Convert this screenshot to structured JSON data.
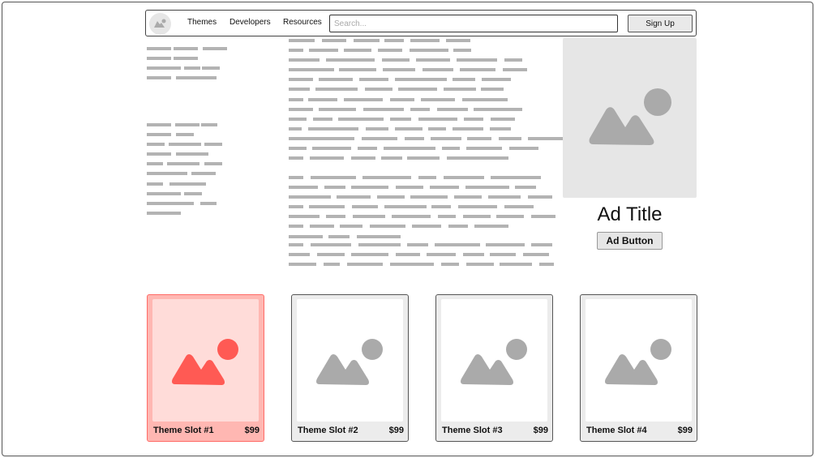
{
  "navbar": {
    "logo_icon": "image-placeholder-icon",
    "links": [
      "Themes",
      "Developers",
      "Resources"
    ],
    "search_placeholder": "Search...",
    "signup_label": "Sign Up"
  },
  "ad": {
    "image_icon": "image-placeholder-icon",
    "title": "Ad Title",
    "button_label": "Ad Button"
  },
  "themes": [
    {
      "name": "Theme Slot #1",
      "price": "$99",
      "selected": true
    },
    {
      "name": "Theme Slot #2",
      "price": "$99",
      "selected": false
    },
    {
      "name": "Theme Slot #3",
      "price": "$99",
      "selected": false
    },
    {
      "name": "Theme Slot #4",
      "price": "$99",
      "selected": false
    }
  ],
  "colors": {
    "placeholder_gray": "#b3b3b3",
    "image_gray": "#e6e6e6",
    "image_shape_gray": "#aaaaaa",
    "selected_card": "#ffb7b2",
    "selected_accent": "#ff5a54"
  }
}
